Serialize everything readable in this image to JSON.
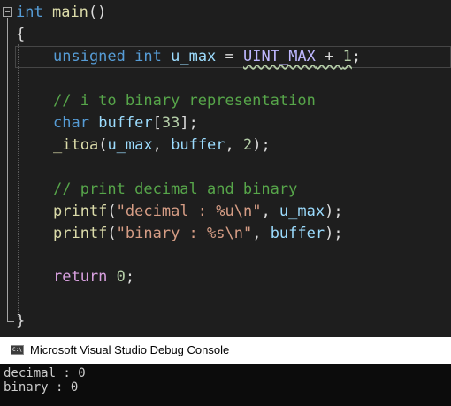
{
  "editor": {
    "lines": {
      "l1": {
        "kw_int": "int",
        "fn_main": "main",
        "p_open": "()"
      },
      "l2": {
        "brace": "{"
      },
      "l3": {
        "kw_unsigned": "unsigned",
        "sp1": " ",
        "kw_int": "int",
        "sp2": " ",
        "var_u_max": "u_max",
        "op_eq": " = ",
        "mac_uint_max": "UINT_MAX",
        "op_plus": " + ",
        "num_1": "1",
        "semi": ";"
      },
      "l5": {
        "comment": "// i to binary representation"
      },
      "l6": {
        "kw_char": "char",
        "sp": " ",
        "var_buffer": "buffer",
        "br_open": "[",
        "num_33": "33",
        "br_close": "];"
      },
      "l7": {
        "fn_itoa": "_itoa",
        "p_open": "(",
        "var_u_max": "u_max",
        "comma1": ", ",
        "var_buffer": "buffer",
        "comma2": ", ",
        "num_2": "2",
        "p_close": ");"
      },
      "l9": {
        "comment": "// print decimal and binary"
      },
      "l10": {
        "fn_printf": "printf",
        "p_open": "(",
        "str_fmt": "\"decimal : %u\\n\"",
        "comma": ", ",
        "var_u_max": "u_max",
        "p_close": ");"
      },
      "l11": {
        "fn_printf": "printf",
        "p_open": "(",
        "str_fmt": "\"binary : %s\\n\"",
        "comma": ", ",
        "var_buffer": "buffer",
        "p_close": ");"
      },
      "l13": {
        "kw_return": "return",
        "sp": " ",
        "num_0": "0",
        "semi": ";"
      },
      "l15": {
        "brace": "}"
      }
    }
  },
  "console": {
    "title": "Microsoft Visual Studio Debug Console",
    "icon": "console-icon",
    "output": [
      "decimal : 0",
      "binary : 0"
    ]
  }
}
